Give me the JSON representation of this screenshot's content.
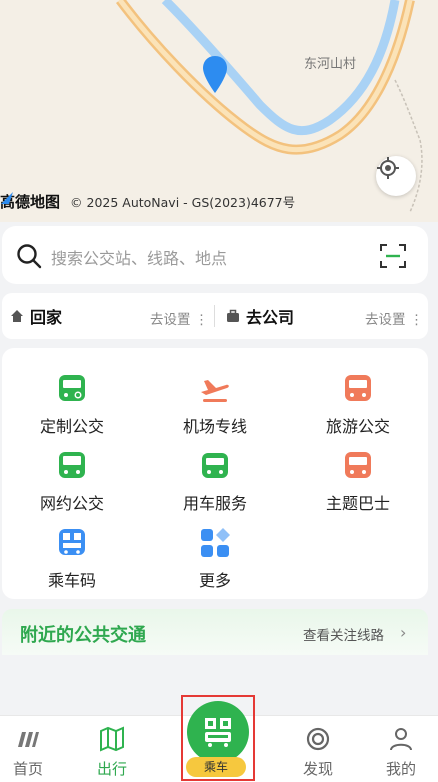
{
  "map": {
    "village_label": "东河山村",
    "brand": "高德地图",
    "copyright": "© 2025 AutoNavi - GS(2023)4677号"
  },
  "search": {
    "placeholder": "搜索公交站、线路、地点"
  },
  "quick": {
    "home_label": "回家",
    "home_action": "去设置",
    "company_label": "去公司",
    "company_action": "去设置"
  },
  "services": [
    {
      "label": "定制公交",
      "icon": "custom-bus-icon",
      "color": "#2fb34f"
    },
    {
      "label": "机场专线",
      "icon": "airplane-icon",
      "color": "#f07a5a"
    },
    {
      "label": "旅游公交",
      "icon": "tour-bus-icon",
      "color": "#f07a5a"
    },
    {
      "label": "网约公交",
      "icon": "online-bus-icon",
      "color": "#2fb34f"
    },
    {
      "label": "用车服务",
      "icon": "car-service-icon",
      "color": "#2fb34f"
    },
    {
      "label": "主题巴士",
      "icon": "theme-bus-icon",
      "color": "#f07a5a"
    },
    {
      "label": "乘车码",
      "icon": "bus-qr-icon",
      "color": "#3b8ff3"
    },
    {
      "label": "更多",
      "icon": "more-grid-icon",
      "color": "#3b8ff3"
    }
  ],
  "nearby": {
    "title": "附近的公共交通",
    "more": "查看关注线路"
  },
  "nav": {
    "home": "首页",
    "travel": "出行",
    "ride": "乘车",
    "discover": "发现",
    "mine": "我的"
  },
  "colors": {
    "accent": "#2fb34f",
    "highlight_border": "#e53935",
    "badge": "#f6c83e"
  }
}
